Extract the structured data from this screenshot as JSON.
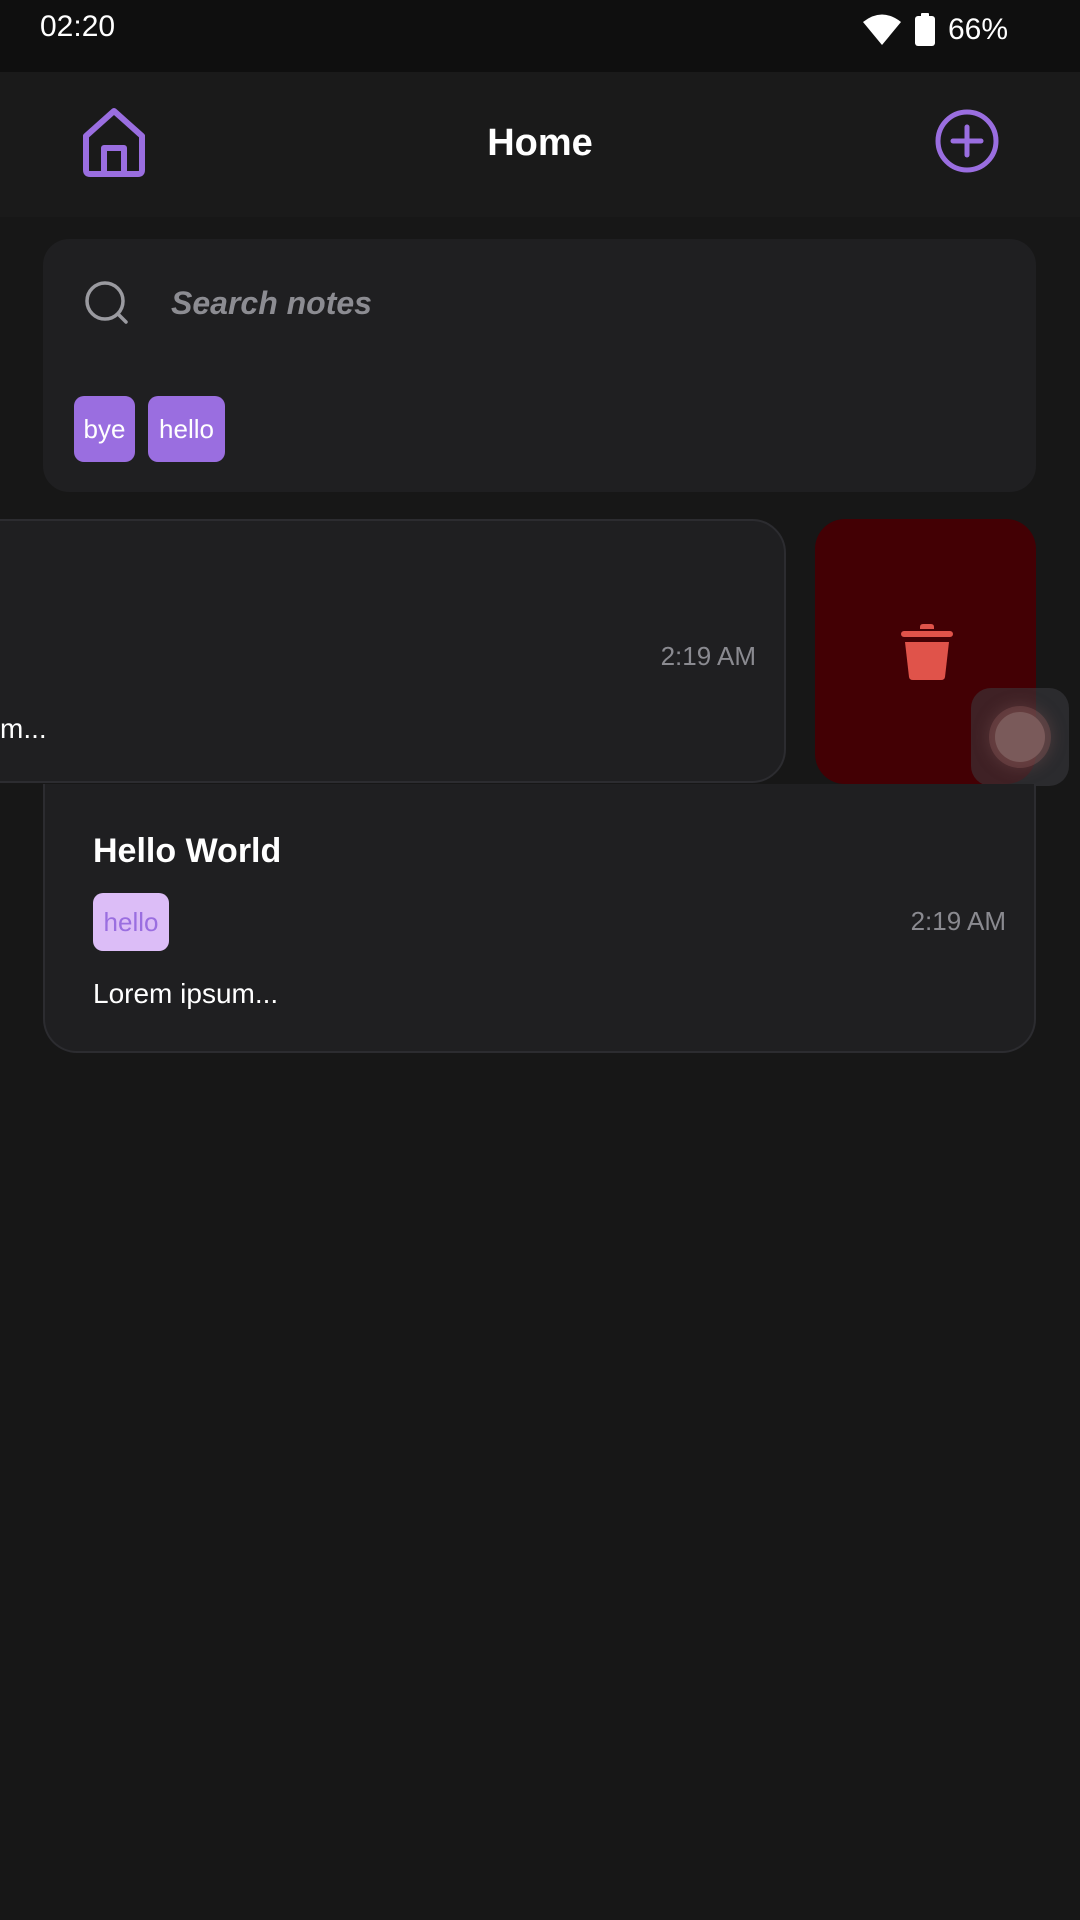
{
  "status_bar": {
    "time": "02:20",
    "battery": "66%",
    "icons": [
      "wifi-icon",
      "battery-icon"
    ]
  },
  "header": {
    "title": "Home",
    "left_icon": "home-icon",
    "right_icon": "add-circle-icon"
  },
  "search": {
    "placeholder": "Search notes",
    "value": ""
  },
  "tag_filters": [
    {
      "label": "bye"
    },
    {
      "label": "hello"
    }
  ],
  "notes": [
    {
      "title": "",
      "time": "2:19 AM",
      "preview": "m...",
      "swiped_open": true
    },
    {
      "title": "Hello World",
      "tag": "hello",
      "time": "2:19 AM",
      "preview": "Lorem ipsum..."
    }
  ],
  "colors": {
    "accent": "#9a6ee0",
    "background": "#171717",
    "card": "#1f1f21",
    "delete_bg": "#430004",
    "delete_icon": "#e0534a",
    "tag_light_bg": "#dcbdf7"
  }
}
